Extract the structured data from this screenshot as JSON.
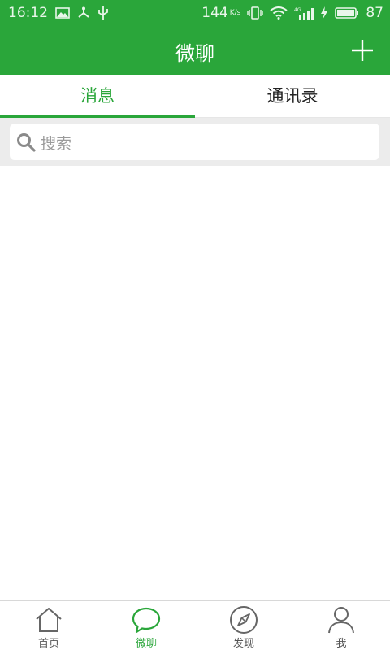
{
  "status_bar": {
    "time": "16:12",
    "network_speed": "144",
    "network_speed_unit": "K/s",
    "battery_level": "87",
    "icons": [
      "image-icon",
      "share-icon",
      "usb-icon",
      "vibrate-icon",
      "wifi-icon",
      "signal-4g-icon",
      "charging-icon",
      "battery-icon"
    ]
  },
  "header": {
    "title": "微聊",
    "add_icon": "plus-icon"
  },
  "tabs": [
    {
      "label": "消息",
      "active": true
    },
    {
      "label": "通讯录",
      "active": false
    }
  ],
  "search": {
    "placeholder": "搜索",
    "icon": "search-icon"
  },
  "bottom_nav": [
    {
      "label": "首页",
      "icon": "home-icon",
      "active": false
    },
    {
      "label": "微聊",
      "icon": "chat-bubble-icon",
      "active": true
    },
    {
      "label": "发现",
      "icon": "compass-icon",
      "active": false
    },
    {
      "label": "我",
      "icon": "user-icon",
      "active": false
    }
  ],
  "colors": {
    "primary": "#2aa63a",
    "inactive_text": "#555555",
    "search_bg": "#ececec",
    "placeholder": "#9a9a9a"
  }
}
